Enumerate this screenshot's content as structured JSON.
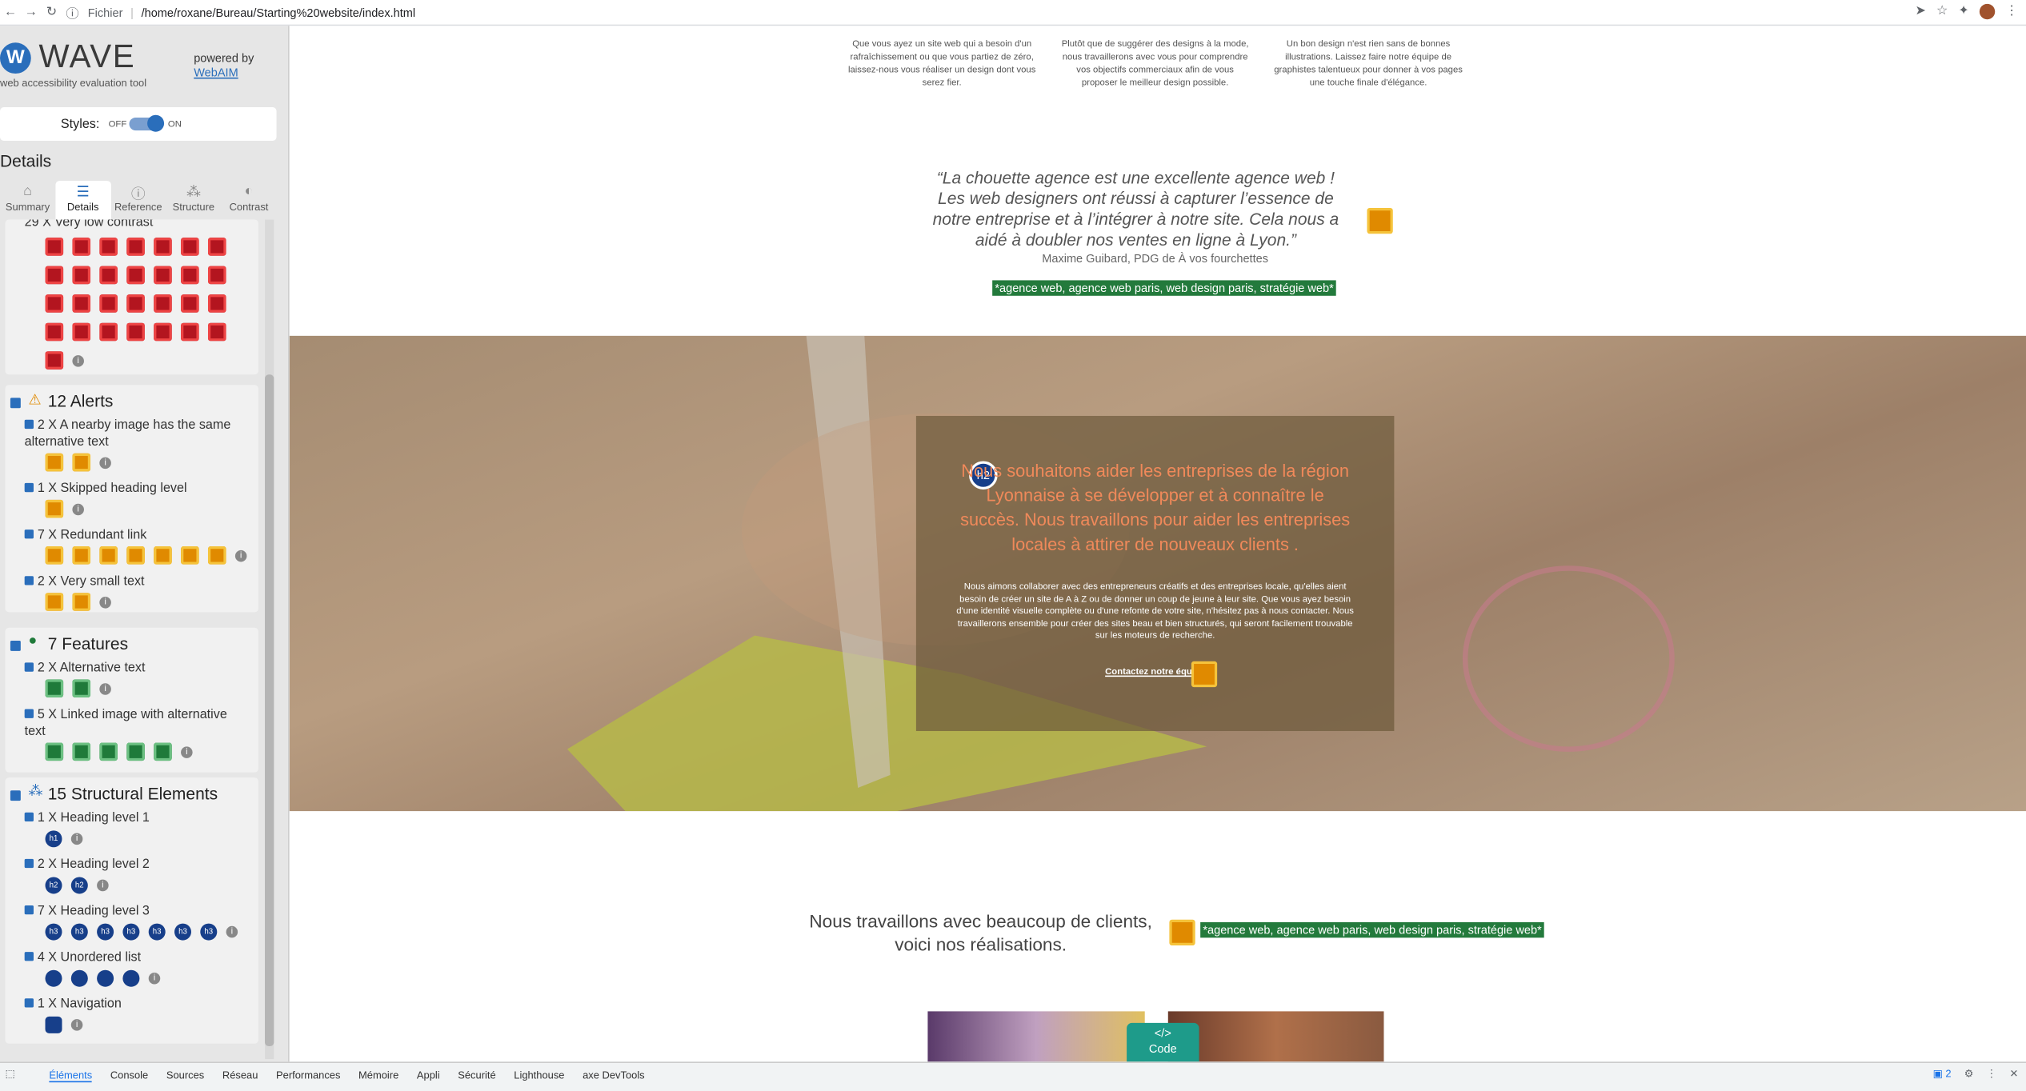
{
  "browser": {
    "file_label": "Fichier",
    "url": "/home/roxane/Bureau/Starting%20website/index.html"
  },
  "wave": {
    "logo_word": "WAVE",
    "tagline": "web accessibility evaluation tool",
    "powered_by": "powered by",
    "webaim": "WebAIM",
    "styles_label": "Styles:",
    "styles_off": "OFF",
    "styles_on": "ON",
    "details_title": "Details",
    "tabs": [
      "Summary",
      "Details",
      "Reference",
      "Structure",
      "Contrast"
    ],
    "contrast_item": "29 X Very low contrast",
    "alerts_title": "12 Alerts",
    "alerts": [
      "2 X A nearby image has the same alternative text",
      "1 X Skipped heading level",
      "7 X Redundant link",
      "2 X Very small text"
    ],
    "features_title": "7 Features",
    "features": [
      "2 X Alternative text",
      "5 X Linked image with alternative text"
    ],
    "structure_title": "15 Structural Elements",
    "structure": [
      "1 X Heading level 1",
      "2 X Heading level 2",
      "7 X Heading level 3",
      "4 X Unordered list",
      "1 X Navigation"
    ],
    "icon_labels": {
      "h1": "h1",
      "h2": "h2",
      "h3": "h3",
      "info": "i"
    }
  },
  "page": {
    "intro_cols": [
      "Que vous ayez un site web qui a besoin d'un rafraîchissement ou que vous partiez de zéro, laissez-nous vous réaliser un design dont vous serez fier.",
      "Plutôt que de suggérer des designs à la mode, nous travaillerons avec vous pour comprendre vos objectifs commerciaux afin de vous proposer le meilleur design possible.",
      "Un bon design n'est rien sans de bonnes illustrations. Laissez faire notre équipe de graphistes talentueux pour donner à vos pages une touche finale d'élégance."
    ],
    "quote": "“La chouette agence est une excellente agence web ! Les web designers ont réussi à capturer l’essence de notre entreprise et à l’intégrer à notre site. Cela nous a aidé à doubler nos ventes en ligne à Lyon.”",
    "quote_author": "Maxime Guibard, PDG de À vos fourchettes",
    "alt_tag_1": "*agence web, agence web paris, web design paris, stratégie web*",
    "h2_badge": "h2",
    "overlay_title": "Nous souhaitons aider les entreprises de la région Lyonnaise à se développer et à connaître le succès. Nous travaillons pour aider les entreprises locales à attirer de nouveaux clients .",
    "overlay_body": "Nous aimons collaborer avec des entrepreneurs créatifs et des entreprises locale, qu'elles aient besoin de créer un site de A à Z ou de donner un coup de jeune à leur site. Que vous ayez besoin d'une identité visuelle complète ou d'une refonte de votre site, n'hésitez pas à nous contacter. Nous travaillerons ensemble pour créer des sites beau et bien structurés, qui seront facilement trouvable sur les moteurs de recherche.",
    "overlay_link": "Contactez notre équipe",
    "clients_text": "Nous travaillons avec beaucoup de clients, voici nos réalisations.",
    "alt_tag_2": "*agence web, agence web paris, web design paris, stratégie web*",
    "code_badge": "Code"
  },
  "devtools": {
    "tabs": [
      "Éléments",
      "Console",
      "Sources",
      "Réseau",
      "Performances",
      "Mémoire",
      "Appli",
      "Sécurité",
      "Lighthouse",
      "axe DevTools"
    ],
    "issues_count": "2"
  },
  "colors": {
    "wave_blue": "#2a6ebb",
    "error_red": "#b3151f",
    "alert_orange": "#e08a00",
    "feature_green": "#1f7a3a",
    "overlay_title": "#f0895a"
  }
}
